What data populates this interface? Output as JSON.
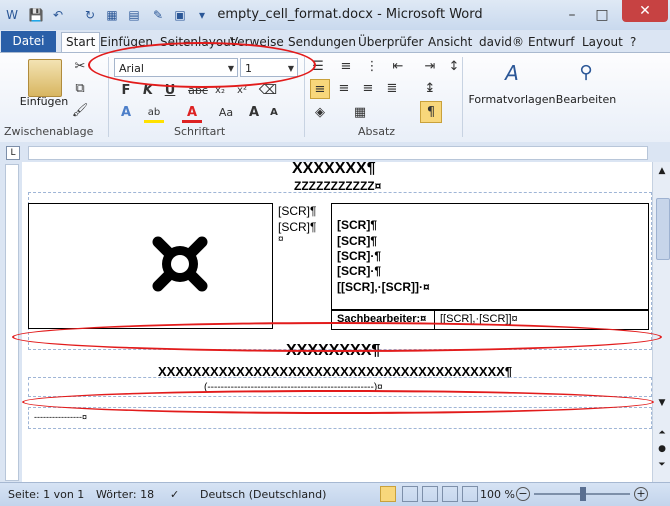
{
  "window": {
    "title": "empty_cell_format.docx - Microsoft Word",
    "minimize": "–",
    "maximize": "□",
    "close": "✕"
  },
  "tabs": {
    "file": "Datei",
    "items": [
      "Start",
      "Einfügen",
      "Seitenlayout",
      "Verweise",
      "Sendungen",
      "Überprüfer",
      "Ansicht",
      "david®",
      "Entwurf",
      "Layout"
    ]
  },
  "ribbon": {
    "paste_label": "Einfügen",
    "clipboard_group": "Zwischenablage",
    "font_group": "Schriftart",
    "paragraph_group": "Absatz",
    "font_name": "Arial",
    "font_size": "1",
    "styles_label": "Formatvorlagen",
    "edit_label": "Bearbeiten"
  },
  "document": {
    "heading1": "XXXXXXX¶",
    "heading2": "ZZZZZZZZZZZ¤",
    "scr_left": [
      "[SCR]¶",
      "[SCR]¶",
      "¤"
    ],
    "scr_right": [
      "[SCR]¶",
      "[SCR]¶",
      "[SCR]·¶",
      "[SCR]·¶",
      "[[SCR],·[SCR]]·¤"
    ],
    "sachbearbeiter_label": "Sachbearbeiter:¤",
    "sachbearbeiter_value": "[[SCR],·[SCR]]¤",
    "heading3": "XXXXXXXX¶",
    "long_line": "XXXXXXXXXXXXXXXXXXXXXXXXXXXXXXXXXXXXXXXX¶",
    "paren_line": "(--------------------------------------------------)¤",
    "short_line": "----------------¤"
  },
  "status": {
    "page": "Seite: 1 von 1",
    "words": "Wörter: 18",
    "language": "Deutsch (Deutschland)",
    "zoom": "100 %"
  },
  "colors": {
    "accent": "#2a5fa8",
    "annotation": "#e21b1b"
  }
}
